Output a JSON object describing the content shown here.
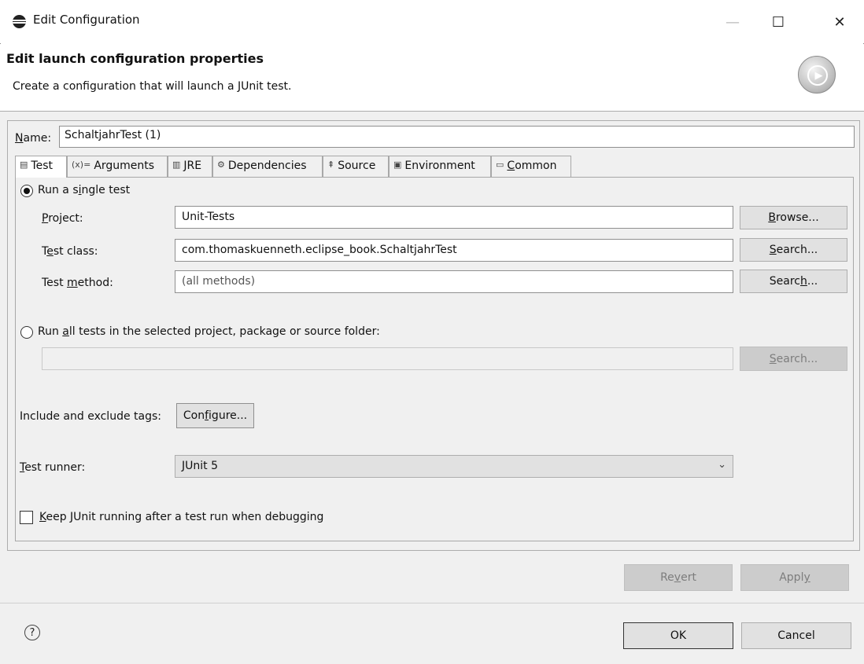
{
  "window": {
    "title": "Edit Configuration",
    "controls": {
      "minimize": "—",
      "maximize": "☐",
      "close": "✕"
    }
  },
  "header": {
    "title": "Edit launch configuration properties",
    "description": "Create a configuration that will launch a JUnit test.",
    "icon": "run-icon"
  },
  "name_field": {
    "label_prefix": "N",
    "label_rest": "ame:",
    "value": "SchaltjahrTest (1)"
  },
  "tabs": [
    {
      "icon": "▤",
      "label": "Test",
      "active": true
    },
    {
      "icon": "(x)=",
      "label": "Arguments"
    },
    {
      "icon": "▥",
      "label": "JRE"
    },
    {
      "icon": "⚙",
      "label": "Dependencies"
    },
    {
      "icon": "⇞",
      "label": "Source"
    },
    {
      "icon": "▣",
      "label": "Environment"
    },
    {
      "icon": "▭",
      "label_u": "C",
      "label_rest": "ommon"
    }
  ],
  "single_test": {
    "radio_label_a": "Run a s",
    "radio_label_u": "i",
    "radio_label_b": "ngle test",
    "project_label_u": "P",
    "project_label_rest": "roject:",
    "project_value": "Unit-Tests",
    "browse_u": "B",
    "browse_rest": "rowse...",
    "test_class_label_a": "T",
    "test_class_label_u": "e",
    "test_class_label_b": "st class:",
    "test_class_value": "com.thomaskuenneth.eclipse_book.SchaltjahrTest",
    "search1_u": "S",
    "search1_rest": "earch...",
    "test_method_label_a": "Test ",
    "test_method_label_u": "m",
    "test_method_label_b": "ethod:",
    "test_method_placeholder": "(all methods)",
    "search2_a": "Searc",
    "search2_u": "h",
    "search2_b": "..."
  },
  "all_tests": {
    "radio_label_a": "Run ",
    "radio_label_u": "a",
    "radio_label_b": "ll tests in the selected project, package or source folder:",
    "value": "",
    "search_u": "S",
    "search_rest": "earch..."
  },
  "tags": {
    "label": "Include and exclude tags:",
    "button_a": "Con",
    "button_u": "f",
    "button_b": "igure..."
  },
  "runner": {
    "label_u": "T",
    "label_rest": "est runner:",
    "selected": "JUnit 5",
    "arrow": "⌄"
  },
  "keep_running": {
    "label_u": "K",
    "label_rest": "eep JUnit running after a test run when debugging",
    "checked": false
  },
  "actions": {
    "revert_a": "Re",
    "revert_u": "v",
    "revert_b": "ert",
    "apply_a": "Appl",
    "apply_u": "y",
    "apply_b": ""
  },
  "footer": {
    "help": "?",
    "ok": "OK",
    "cancel": "Cancel"
  }
}
